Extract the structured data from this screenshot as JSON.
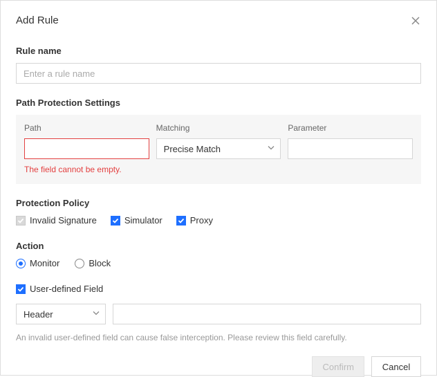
{
  "dialog": {
    "title": "Add Rule"
  },
  "ruleName": {
    "label": "Rule name",
    "placeholder": "Enter a rule name",
    "value": ""
  },
  "pathSettings": {
    "label": "Path Protection Settings",
    "path": {
      "label": "Path",
      "value": "",
      "error": "The field cannot be empty."
    },
    "matching": {
      "label": "Matching",
      "value": "Precise Match"
    },
    "parameter": {
      "label": "Parameter",
      "value": ""
    }
  },
  "policy": {
    "label": "Protection Policy",
    "items": {
      "invalidSignature": {
        "label": "Invalid Signature",
        "checked": true,
        "disabled": true
      },
      "simulator": {
        "label": "Simulator",
        "checked": true,
        "disabled": false
      },
      "proxy": {
        "label": "Proxy",
        "checked": true,
        "disabled": false
      }
    }
  },
  "action": {
    "label": "Action",
    "options": {
      "monitor": {
        "label": "Monitor",
        "selected": true
      },
      "block": {
        "label": "Block",
        "selected": false
      }
    }
  },
  "userDefined": {
    "label": "User-defined Field",
    "checked": true,
    "type": "Header",
    "value": ""
  },
  "hint": "An invalid user-defined field can cause false interception. Please review this field carefully.",
  "buttons": {
    "confirm": "Confirm",
    "cancel": "Cancel"
  }
}
